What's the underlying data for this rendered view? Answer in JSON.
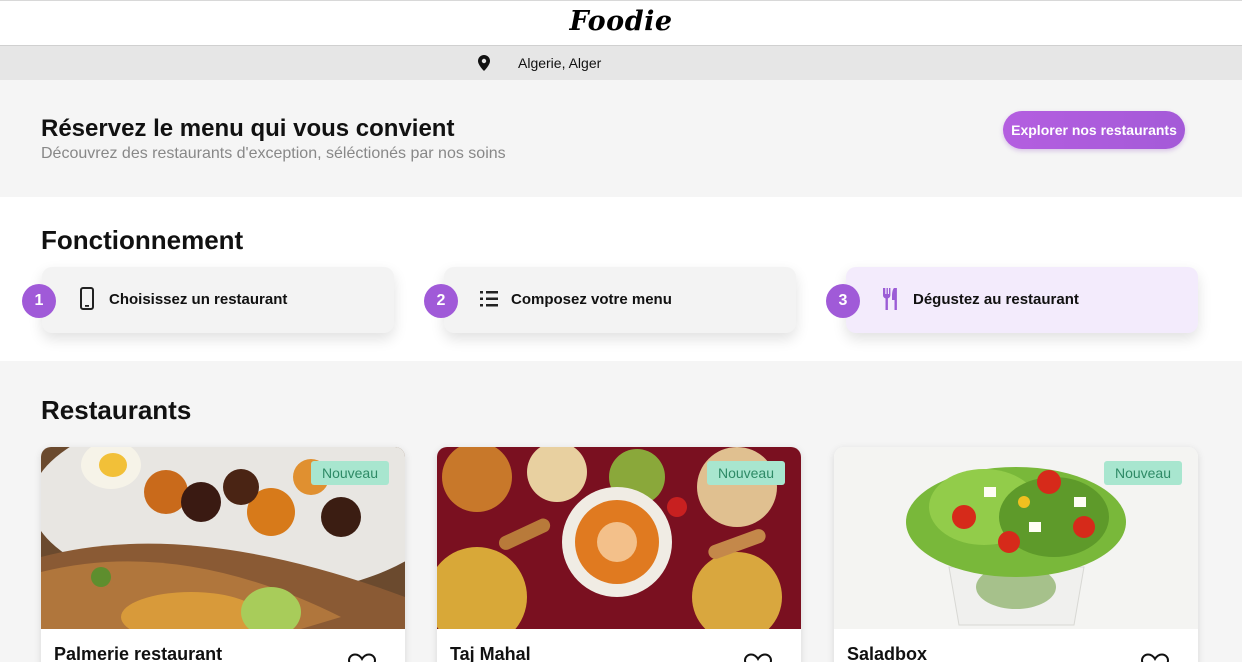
{
  "header": {
    "logo": "Foodie"
  },
  "location": {
    "icon": "map-pin-icon",
    "text": "Algerie, Alger"
  },
  "hero": {
    "title": "Réservez le menu qui vous convient",
    "subtitle": "Découvrez des restaurants d'exception, séléctionés par nos soins",
    "cta_label": "Explorer nos restaurants"
  },
  "how": {
    "title": "Fonctionnement",
    "steps": [
      {
        "number": "1",
        "icon": "smartphone-icon",
        "label": "Choisissez un restaurant"
      },
      {
        "number": "2",
        "icon": "list-icon",
        "label": "Composez votre menu"
      },
      {
        "number": "3",
        "icon": "fork-knife-icon",
        "label": "Dégustez au restaurant",
        "active": true
      }
    ]
  },
  "restaurants": {
    "title": "Restaurants",
    "items": [
      {
        "name": "Palmerie restaurant",
        "badge": "Nouveau"
      },
      {
        "name": "Taj Mahal",
        "badge": "Nouveau"
      },
      {
        "name": "Saladbox",
        "badge": "Nouveau"
      }
    ]
  },
  "colors": {
    "accent": "#a05ad8",
    "badge_bg": "#a8e6cf",
    "badge_text": "#2e8a66",
    "active_step_bg": "#f3ebfc"
  }
}
